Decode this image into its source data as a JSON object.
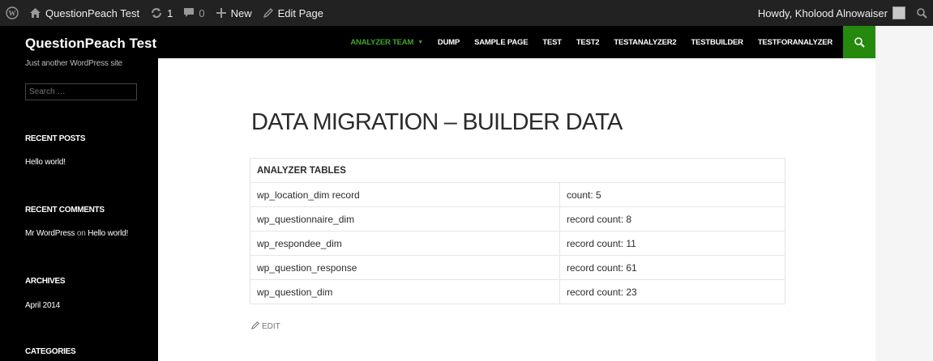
{
  "adminbar": {
    "site_name": "QuestionPeach Test",
    "updates_count": "1",
    "comments_count": "0",
    "new_label": "New",
    "edit_page_label": "Edit Page",
    "howdy": "Howdy, Kholood Alnowaiser"
  },
  "sidebar": {
    "site_title": "QuestionPeach Test",
    "site_desc": "Just another WordPress site",
    "search_placeholder": "Search …",
    "recent_posts_title": "RECENT POSTS",
    "recent_post": "Hello world!",
    "recent_comments_title": "RECENT COMMENTS",
    "comment_author": "Mr WordPress",
    "comment_on": " on ",
    "comment_post": "Hello world!",
    "archives_title": "ARCHIVES",
    "archive_item": "April 2014",
    "categories_title": "CATEGORIES"
  },
  "nav": {
    "items": [
      "ANALYZER TEAM",
      "DUMP",
      "SAMPLE PAGE",
      "TEST",
      "TEST2",
      "TESTANALYZER2",
      "TESTBUILDER",
      "TESTFORANALYZER"
    ],
    "active_color": "#41a62a"
  },
  "main": {
    "title": "DATA MIGRATION – BUILDER DATA",
    "table_header": "ANALYZER TABLES",
    "rows": [
      {
        "name": "wp_location_dim record",
        "count": "count: 5"
      },
      {
        "name": "wp_questionnaire_dim",
        "count": "record count: 8"
      },
      {
        "name": "wp_respondee_dim",
        "count": "record count: 11"
      },
      {
        "name": "wp_question_response",
        "count": "record count: 61"
      },
      {
        "name": "wp_question_dim",
        "count": "record count: 23"
      }
    ],
    "edit_label": "EDIT"
  },
  "icons": {
    "wordpress": "wordpress-logo-icon",
    "home": "home-icon",
    "updates": "updates-icon",
    "comments": "comment-icon",
    "new": "plus-icon",
    "edit": "pencil-icon",
    "search": "search-icon"
  },
  "colors": {
    "adminbar_bg": "#222222",
    "sidebar_bg": "#000000",
    "accent_green": "#24890d"
  }
}
